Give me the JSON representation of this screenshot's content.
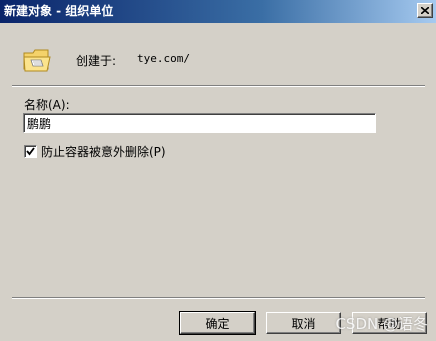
{
  "window": {
    "title": "新建对象 - 组织单位"
  },
  "info": {
    "created_label": "创建于:",
    "created_value": "tye.com/",
    "folder_icon": "folder-icon"
  },
  "form": {
    "name_label": "名称(A):",
    "name_value": "鹏鹏",
    "protect_label": "防止容器被意外删除(P)",
    "protect_checked": true
  },
  "buttons": {
    "ok": "确定",
    "cancel": "取消",
    "help": "帮助"
  },
  "watermark": "CSDN @语冬"
}
